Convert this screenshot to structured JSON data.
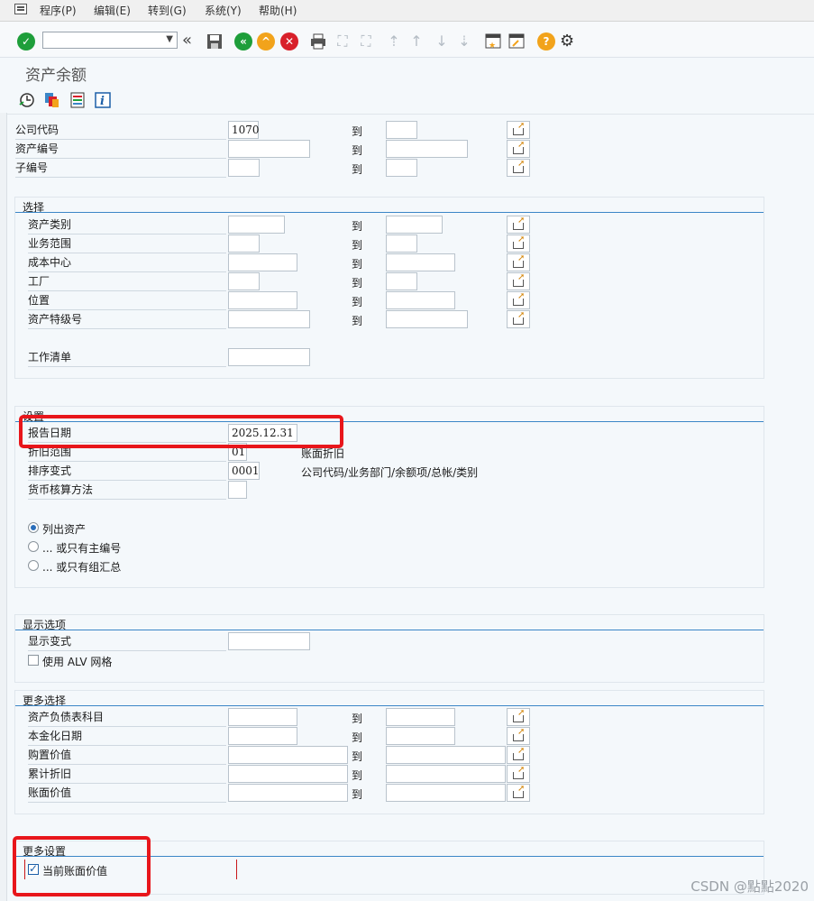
{
  "menu": {
    "program": "程序(P)",
    "edit": "编辑(E)",
    "goto": "转到(G)",
    "system": "系统(Y)",
    "help": "帮助(H)"
  },
  "screen_title": "资产余额",
  "to_label": "到",
  "header_fields": [
    {
      "label": "公司代码",
      "low": "1070",
      "high": ""
    },
    {
      "label": "资产编号",
      "low": "",
      "high": ""
    },
    {
      "label": "子编号",
      "low": "",
      "high": ""
    }
  ],
  "selection": {
    "title": "选择",
    "fields": [
      {
        "label": "资产类别",
        "low": "",
        "high": ""
      },
      {
        "label": "业务范围",
        "low": "",
        "high": ""
      },
      {
        "label": "成本中心",
        "low": "",
        "high": ""
      },
      {
        "label": "工厂",
        "low": "",
        "high": ""
      },
      {
        "label": "位置",
        "low": "",
        "high": ""
      },
      {
        "label": "资产特级号",
        "low": "",
        "high": ""
      }
    ],
    "worklist_label": "工作清单",
    "worklist_value": ""
  },
  "settings": {
    "title": "设置",
    "report_date_label": "报告日期",
    "report_date_value": "2025.12.31",
    "dep_area_label": "折旧范围",
    "dep_area_value": "01",
    "dep_area_desc": "账面折旧",
    "sort_label": "排序变式",
    "sort_value": "0001",
    "sort_desc": "公司代码/业务部门/余额项/总帐/类别",
    "currency_label": "货币核算方法",
    "currency_value": "",
    "radio_list_assets": "列出资产",
    "radio_main_only": "... 或只有主编号",
    "radio_group_only": "... 或只有组汇总"
  },
  "display": {
    "title": "显示选项",
    "variant_label": "显示变式",
    "variant_value": "",
    "alv_label": "使用 ALV 网格"
  },
  "more_selection": {
    "title": "更多选择",
    "fields": [
      {
        "label": "资产负债表科目",
        "low": "",
        "high": ""
      },
      {
        "label": "本金化日期",
        "low": "",
        "high": ""
      },
      {
        "label": "购置价值",
        "low": "",
        "high": ""
      },
      {
        "label": "累计折旧",
        "low": "",
        "high": ""
      },
      {
        "label": "账面价值",
        "low": "",
        "high": ""
      }
    ]
  },
  "more_settings": {
    "title": "更多设置",
    "current_bv_label": "当前账面价值"
  },
  "watermark": "CSDN @點點2020",
  "colors": {
    "accent": "#3b86c7",
    "highlight": "#e8161b",
    "ok": "#1e9e3a",
    "warn": "#f2a31b",
    "cancel": "#d8202a"
  }
}
